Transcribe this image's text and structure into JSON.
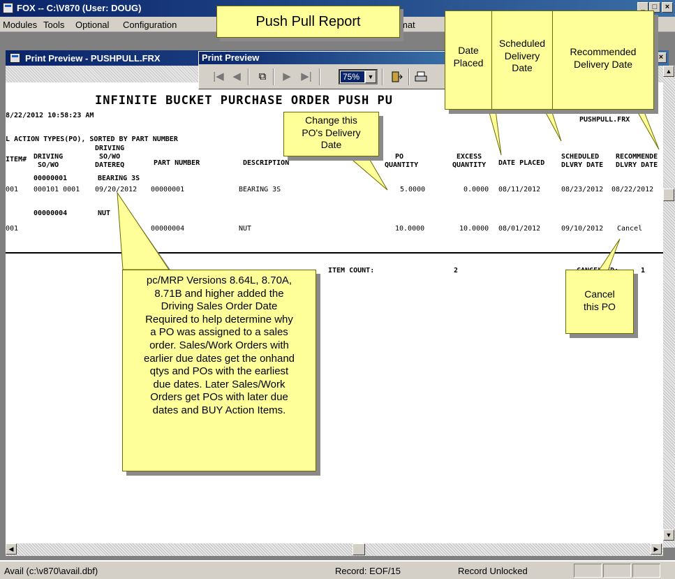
{
  "window": {
    "title": "FOX -- C:\\V870  (User: DOUG)",
    "controls": [
      "_",
      "□",
      "×"
    ]
  },
  "menu": [
    "Modules",
    "Tools",
    "Optional",
    "Configuration",
    "mat"
  ],
  "child_window": {
    "title": "Print Preview - PUSHPULL.FRX",
    "close": "×"
  },
  "print_preview_toolbar": {
    "title": "Print Preview",
    "zoom": "75%",
    "buttons": [
      "first-page",
      "previous-page",
      "go-to-page",
      "next-page",
      "last-page",
      "close-preview",
      "print"
    ]
  },
  "report": {
    "title": "INFINITE BUCKET PURCHASE ORDER PUSH PU",
    "timestamp": "8/22/2012 10:58:23 AM",
    "filter_line": "L ACTION TYPES(PO), SORTED BY PART NUMBER",
    "report_name": "PUSHPULL.FRX",
    "columns": {
      "item": "ITEM#",
      "driving_so_line1": "DRIVING",
      "driving_so_line2": "SO/WO",
      "driving_date_line1": "DRIVING",
      "driving_date_line2": "SO/WO",
      "driving_date_line3": "DATEREQ",
      "part": "PART NUMBER",
      "description": "DESCRIPTION",
      "po_qty_line1": "PO",
      "po_qty_line2": "QUANTITY",
      "excess_line1": "EXCESS",
      "excess_line2": "QUANTITY",
      "date_placed": "DATE PLACED",
      "scheduled_line1": "SCHEDULED",
      "scheduled_line2": "DLVRY DATE",
      "recommended_line1": "RECOMMENDE",
      "recommended_line2": "DLVRY DATE"
    },
    "groups": [
      {
        "part_header": "00000001",
        "desc_header": "BEARING 3S",
        "row": {
          "item": "001",
          "driving_so": "000101  0001",
          "driving_date": "09/20/2012",
          "part": "00000001",
          "description": "BEARING 3S",
          "po_qty": "5.0000",
          "excess_qty": "0.0000",
          "date_placed": "08/11/2012",
          "scheduled": "08/23/2012",
          "recommended": "08/22/2012"
        }
      },
      {
        "part_header": "00000004",
        "desc_header": "NUT",
        "row": {
          "item": "001",
          "driving_so": "",
          "driving_date": "",
          "part": "00000004",
          "description": "NUT",
          "po_qty": "10.0000",
          "excess_qty": "10.0000",
          "date_placed": "08/01/2012",
          "scheduled": "09/10/2012",
          "recommended": "Cancel"
        }
      }
    ],
    "footer": {
      "item_count_label": "ITEM COUNT:",
      "item_count": "2",
      "cancelled_label": "CANCELLED:",
      "cancelled": "1"
    }
  },
  "callouts": {
    "push_pull": "Push Pull Report",
    "date_placed": [
      "Date",
      "Placed"
    ],
    "scheduled": [
      "Scheduled",
      "Delivery",
      "Date"
    ],
    "recommended": [
      "Recommended",
      "Delivery Date"
    ],
    "change_date": [
      "Change this",
      "PO's Delivery",
      "Date"
    ],
    "cancel": [
      "Cancel",
      "this PO"
    ],
    "driving_note": [
      "pc/MRP Versions 8.64L, 8.70A,",
      "8.71B and higher added the",
      "Driving Sales Order Date",
      "Required to help determine why",
      "a PO was assigned to a sales",
      "order.  Sales/Work Orders with",
      "earlier due dates get the onhand",
      "qtys and  POs with the earliest",
      "due dates.  Later Sales/Work",
      "Orders get POs with later due",
      "dates and BUY Action Items."
    ]
  },
  "status_bar": {
    "path": "Avail (c:\\v870\\avail.dbf)",
    "record": "Record: EOF/15",
    "lock": "Record Unlocked"
  },
  "colors": {
    "titlebar": "#0a246a",
    "callout": "#ffff99",
    "face": "#d4d0c8"
  }
}
